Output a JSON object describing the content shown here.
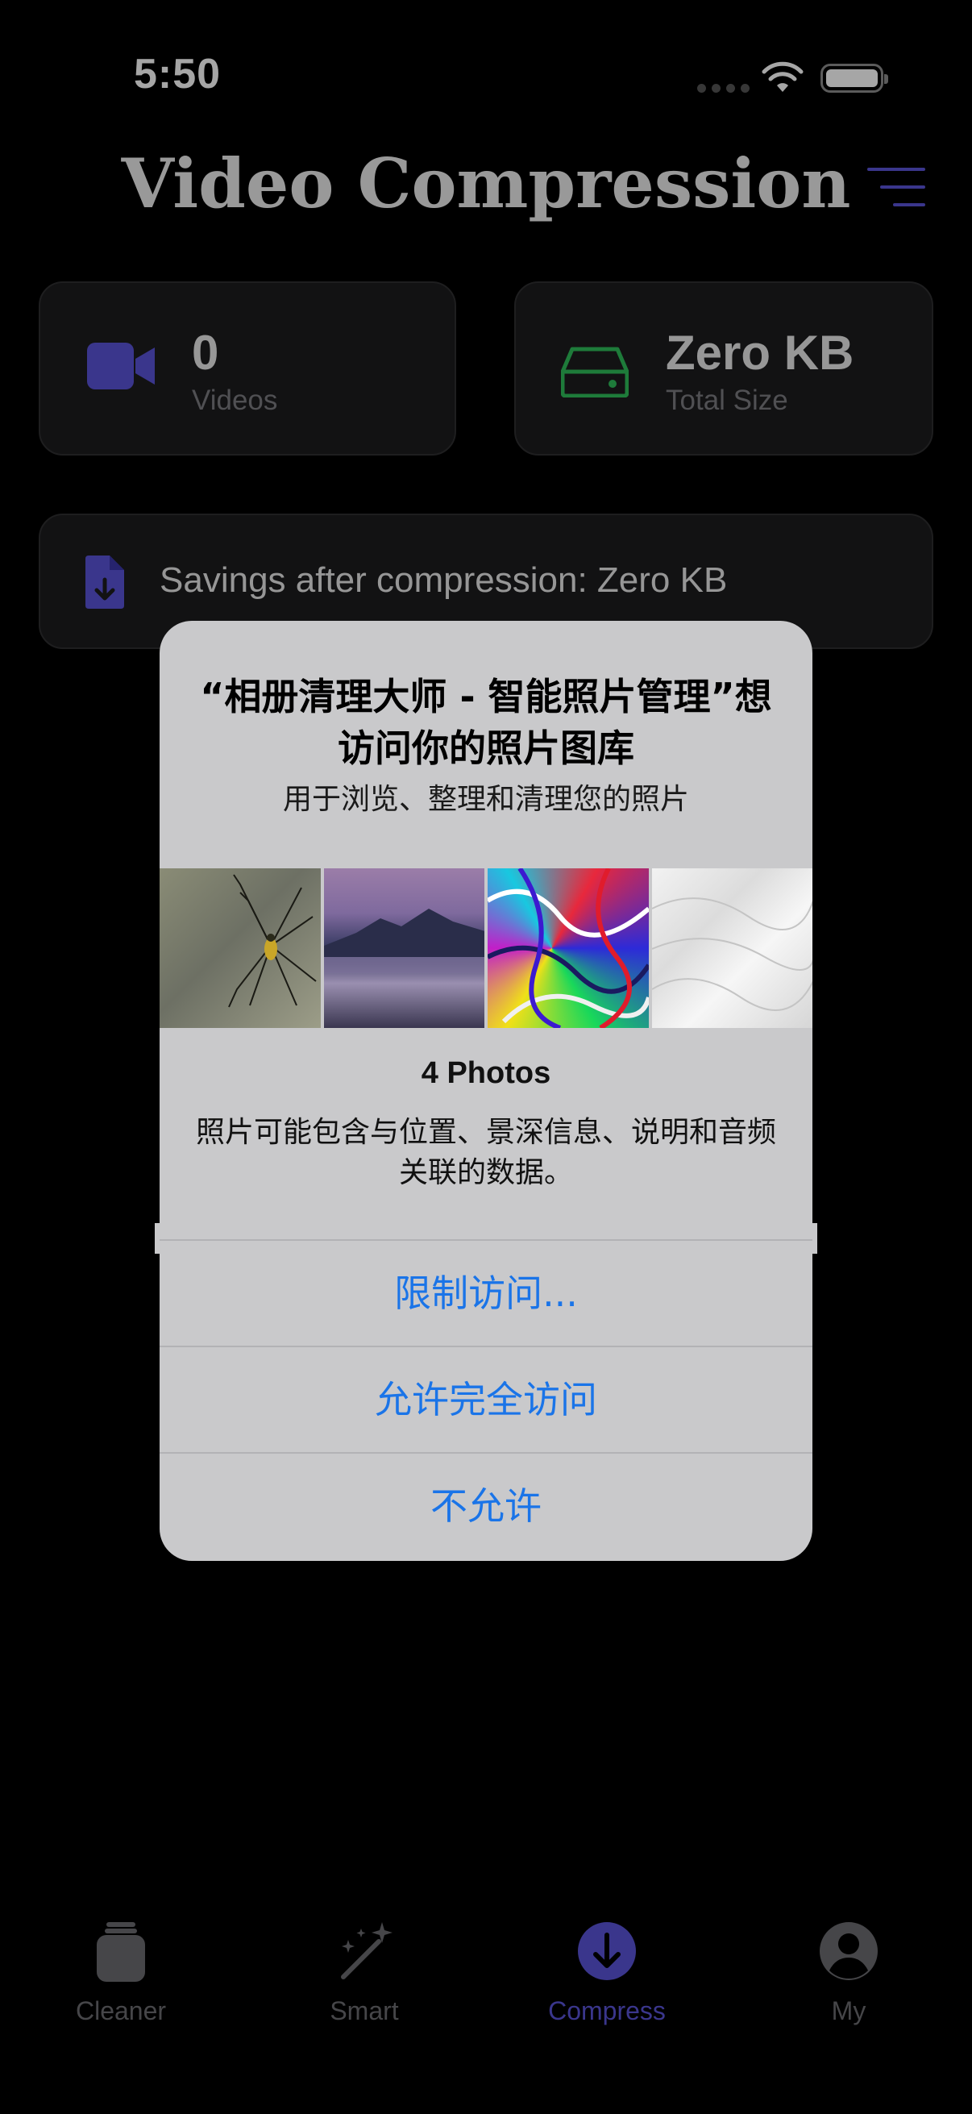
{
  "status_bar": {
    "time": "5:50"
  },
  "header": {
    "title": "Video Compression",
    "menu_icon": "menu-lines-icon"
  },
  "stats": {
    "videos": {
      "value": "0",
      "label": "Videos",
      "icon": "video-camera-icon",
      "icon_color": "#5a54d8"
    },
    "size": {
      "value": "Zero KB",
      "label": "Total Size",
      "icon": "hard-drive-icon",
      "icon_color": "#2ebd5a"
    }
  },
  "savings": {
    "text": "Savings after compression: Zero KB",
    "icon": "file-download-icon",
    "icon_color": "#5a54d8"
  },
  "alert": {
    "title": "“相册清理大师 - 智能照片管理”想访问你的照片图库",
    "message": "用于浏览、整理和清理您的照片",
    "photo_count": "4 Photos",
    "note": "照片可能包含与位置、景深信息、说明和音频关联的数据。",
    "buttons": {
      "limit": "限制访问...",
      "allow_full": "允许完全访问",
      "deny": "不允许"
    }
  },
  "tabs": [
    {
      "label": "Cleaner",
      "icon": "jar-icon",
      "active": false
    },
    {
      "label": "Smart",
      "icon": "magic-wand-icon",
      "active": false
    },
    {
      "label": "Compress",
      "icon": "download-circle-icon",
      "active": true
    },
    {
      "label": "My",
      "icon": "person-circle-icon",
      "active": false
    }
  ],
  "colors": {
    "accent": "#5a54d8",
    "alert_button": "#1a74e8",
    "background": "#000000",
    "card": "#1c1c1e"
  }
}
